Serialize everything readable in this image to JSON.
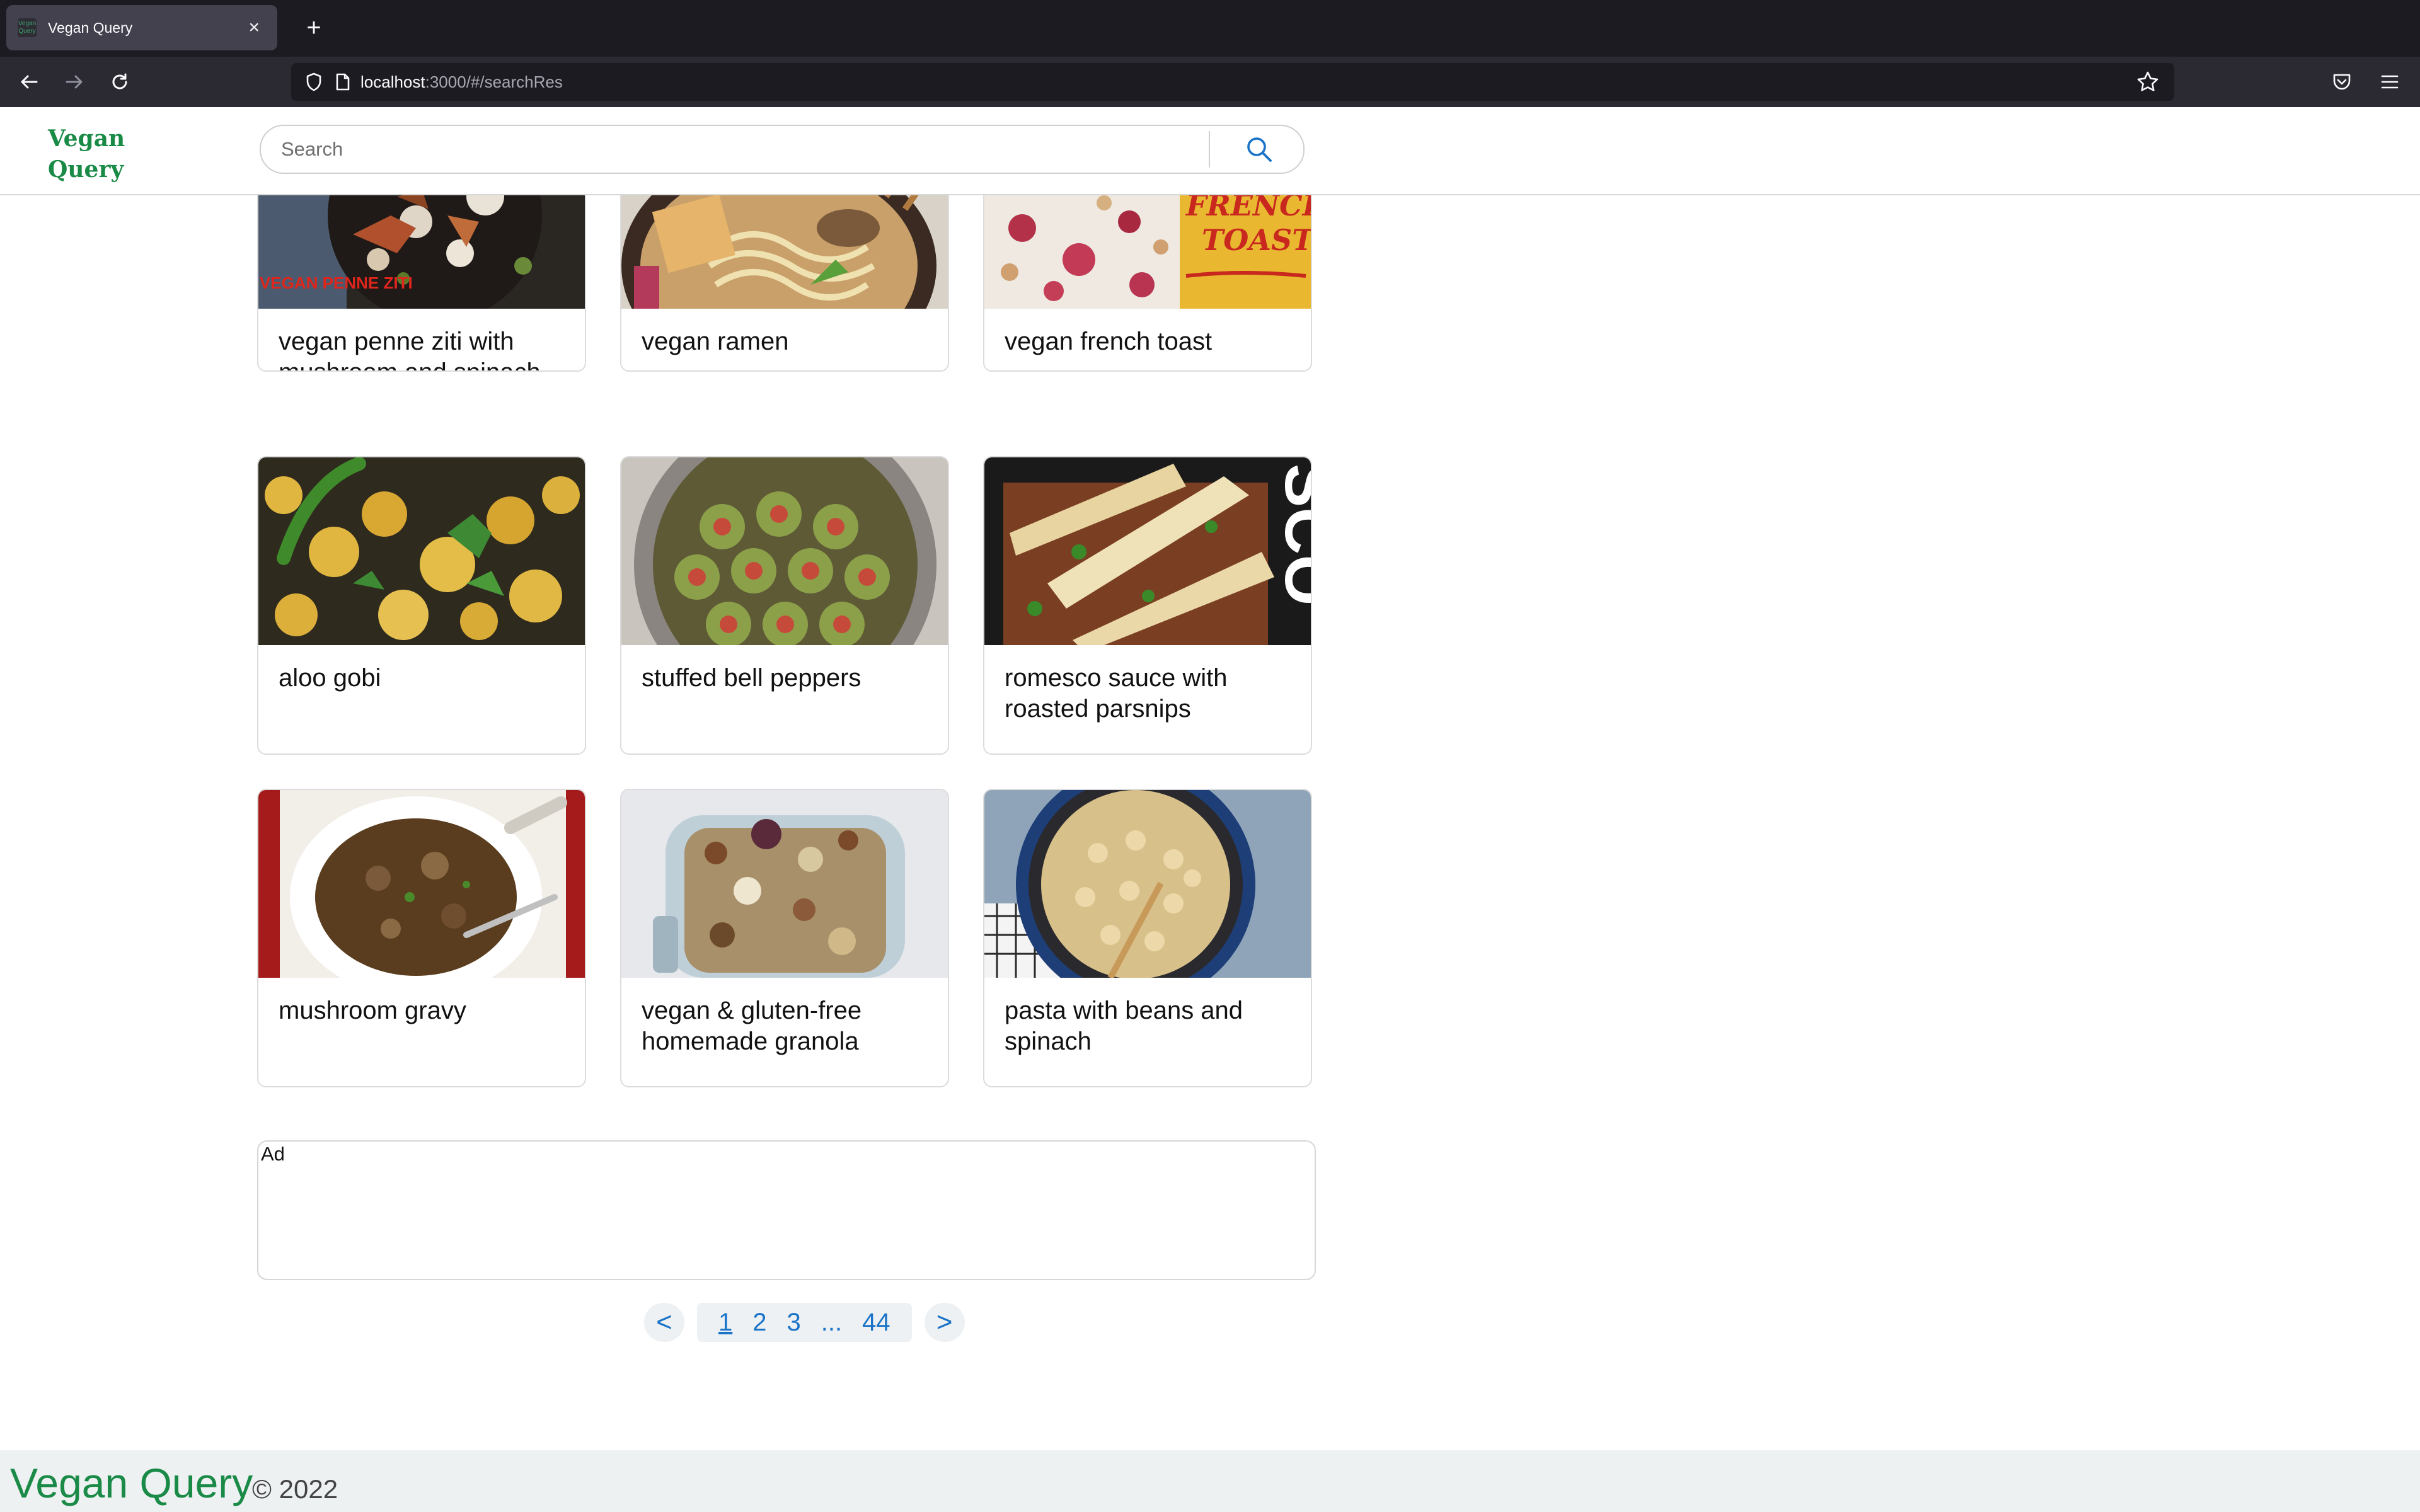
{
  "browser": {
    "tab_title": "Vegan Query",
    "favicon_text": "Vegan Query",
    "url_host": "localhost",
    "url_path": ":3000/#/searchRes"
  },
  "header": {
    "logo_line1": "Vegan",
    "logo_line2": "Query",
    "search_placeholder": "Search"
  },
  "results": [
    {
      "title": "vegan penne ziti with mushroom and spinach",
      "image": "penne-ziti-photo",
      "image_text": "VEGAN PENNE ZITI"
    },
    {
      "title": "vegan ramen",
      "image": "ramen-photo"
    },
    {
      "title": "vegan french toast",
      "image": "french-toast-photo",
      "image_text_1": "FRENCH",
      "image_text_2": "TOAST"
    },
    {
      "title": "aloo gobi",
      "image": "aloo-gobi-photo"
    },
    {
      "title": "stuffed bell peppers",
      "image": "stuffed-peppers-photo"
    },
    {
      "title": "romesco sauce with roasted parsnips",
      "image": "romesco-parsnips-photo",
      "image_text": "SCO"
    },
    {
      "title": "mushroom gravy",
      "image": "mushroom-gravy-photo"
    },
    {
      "title": "vegan & gluten-free homemade granola",
      "image": "granola-photo"
    },
    {
      "title": "pasta with beans and spinach",
      "image": "pasta-beans-photo"
    }
  ],
  "ad_label": "Ad",
  "pagination": {
    "prev": "<",
    "pages": [
      "1",
      "2",
      "3",
      "...",
      "44"
    ],
    "current": "1",
    "next": ">"
  },
  "footer": {
    "brand": "Vegan Query",
    "copyright": "© 2022"
  },
  "colors": {
    "brand_green": "#1a8a47",
    "link_blue": "#1a73c8",
    "chrome_dark": "#1c1b22"
  }
}
